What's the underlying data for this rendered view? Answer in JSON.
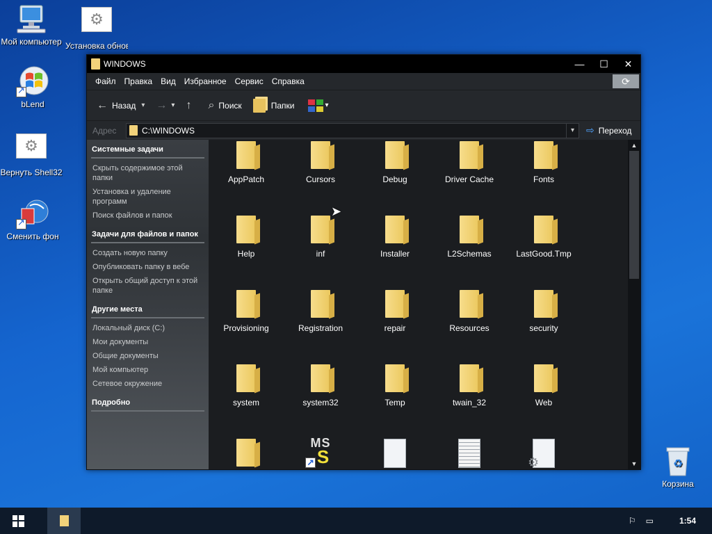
{
  "desktop": {
    "icons": [
      {
        "label": "Мой компьютер"
      },
      {
        "label": "Установка обновлен"
      },
      {
        "label": "bLend"
      },
      {
        "label": "Вернуть Shell32"
      },
      {
        "label": "Сменить фон"
      },
      {
        "label": "Корзина"
      }
    ]
  },
  "window": {
    "title": "WINDOWS",
    "controls": {
      "minimize": "—",
      "maximize": "☐",
      "close": "✕"
    },
    "menu": [
      "Файл",
      "Правка",
      "Вид",
      "Избранное",
      "Сервис",
      "Справка"
    ],
    "toolbar": {
      "back": "Назад",
      "search": "Поиск",
      "folders": "Папки"
    },
    "address": {
      "label": "Адрес",
      "path": "C:\\WINDOWS",
      "go": "Переход"
    },
    "taskpane": {
      "sections": [
        {
          "title": "Системные задачи",
          "links": [
            "Скрыть содержимое этой папки",
            "Установка и удаление программ",
            "Поиск файлов и папок"
          ]
        },
        {
          "title": "Задачи для файлов и папок",
          "links": [
            "Создать новую папку",
            "Опубликовать папку в вебе",
            "Открыть общий доступ к этой папке"
          ]
        },
        {
          "title": "Другие места",
          "links": [
            "Локальный диск (C:)",
            "Мои документы",
            "Общие документы",
            "Мой компьютер",
            "Сетевое окружение"
          ]
        },
        {
          "title": "Подробно",
          "links": []
        }
      ]
    },
    "files": [
      {
        "name": "AppPatch",
        "icon": "folder-icon"
      },
      {
        "name": "Cursors",
        "icon": "folder-icon"
      },
      {
        "name": "Debug",
        "icon": "folder-icon"
      },
      {
        "name": "Driver Cache",
        "icon": "folder-icon"
      },
      {
        "name": "Fonts",
        "icon": "folder-icon"
      },
      {
        "name": "Help",
        "icon": "folder-icon"
      },
      {
        "name": "inf",
        "icon": "folder-icon"
      },
      {
        "name": "Installer",
        "icon": "folder-icon"
      },
      {
        "name": "L2Schemas",
        "icon": "folder-icon"
      },
      {
        "name": "LastGood.Tmp",
        "icon": "folder-icon"
      },
      {
        "name": "Provisioning",
        "icon": "folder-icon"
      },
      {
        "name": "Registration",
        "icon": "folder-icon"
      },
      {
        "name": "repair",
        "icon": "folder-icon"
      },
      {
        "name": "Resources",
        "icon": "folder-icon"
      },
      {
        "name": "security",
        "icon": "folder-icon"
      },
      {
        "name": "system",
        "icon": "folder-icon"
      },
      {
        "name": "system32",
        "icon": "folder-icon"
      },
      {
        "name": "Temp",
        "icon": "folder-icon"
      },
      {
        "name": "twain_32",
        "icon": "folder-icon"
      },
      {
        "name": "Web",
        "icon": "folder-icon"
      },
      {
        "name": "",
        "icon": "folder-icon"
      },
      {
        "name": "",
        "icon": "ms-shortcut-icon"
      },
      {
        "name": "",
        "icon": "blank-document-icon"
      },
      {
        "name": "",
        "icon": "text-document-icon"
      },
      {
        "name": "",
        "icon": "settings-document-icon"
      }
    ]
  },
  "taskbar": {
    "clock": "1:54"
  },
  "colors": {
    "folder": "#f2d27a",
    "window_bg": "#1e2125",
    "desktop": "#1565cf"
  }
}
